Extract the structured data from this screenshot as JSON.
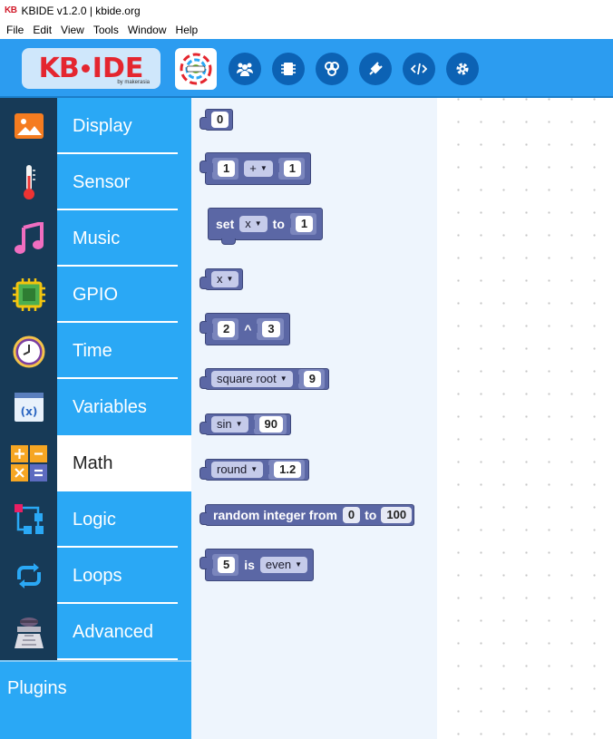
{
  "window": {
    "logo_text": "KB",
    "title": "KBIDE v1.2.0 | kbide.org"
  },
  "menu": [
    "File",
    "Edit",
    "View",
    "Tools",
    "Window",
    "Help"
  ],
  "toolbar": {
    "logo_kb": "KB",
    "logo_ide": "IDE",
    "logo_by": "by makerasia",
    "buttons": [
      "people-icon",
      "board-icon",
      "blocks-icon",
      "plugin-icon",
      "code-icon",
      "settings-icon"
    ]
  },
  "categories": [
    {
      "label": "Display",
      "icon": "display-icon"
    },
    {
      "label": "Sensor",
      "icon": "thermometer-icon"
    },
    {
      "label": "Music",
      "icon": "music-icon"
    },
    {
      "label": "GPIO",
      "icon": "chip-icon"
    },
    {
      "label": "Time",
      "icon": "clock-icon"
    },
    {
      "label": "Variables",
      "icon": "variables-icon"
    },
    {
      "label": "Math",
      "icon": "math-icon",
      "active": true
    },
    {
      "label": "Logic",
      "icon": "logic-icon"
    },
    {
      "label": "Loops",
      "icon": "loops-icon"
    },
    {
      "label": "Advanced",
      "icon": "advanced-icon"
    }
  ],
  "plugins_label": "Plugins",
  "blocks": {
    "number": {
      "value": "0"
    },
    "arith": {
      "a": "1",
      "op": "+",
      "b": "1"
    },
    "set": {
      "label": "set",
      "var": "x",
      "to": "to",
      "value": "1"
    },
    "var": {
      "name": "x"
    },
    "pow": {
      "a": "2",
      "op": "^",
      "b": "3"
    },
    "sqrt": {
      "fn": "square root",
      "value": "9"
    },
    "sin": {
      "fn": "sin",
      "value": "90"
    },
    "round": {
      "fn": "round",
      "value": "1.2"
    },
    "random": {
      "label": "random integer from",
      "from": "0",
      "to_label": "to",
      "to": "100"
    },
    "even": {
      "value": "5",
      "is": "is",
      "prop": "even"
    }
  },
  "colors": {
    "toolbar": "#2c9cf0",
    "sidebar_dark": "#173a57",
    "sidebar": "#2aa8f5",
    "math_block": "#5b67a5"
  }
}
